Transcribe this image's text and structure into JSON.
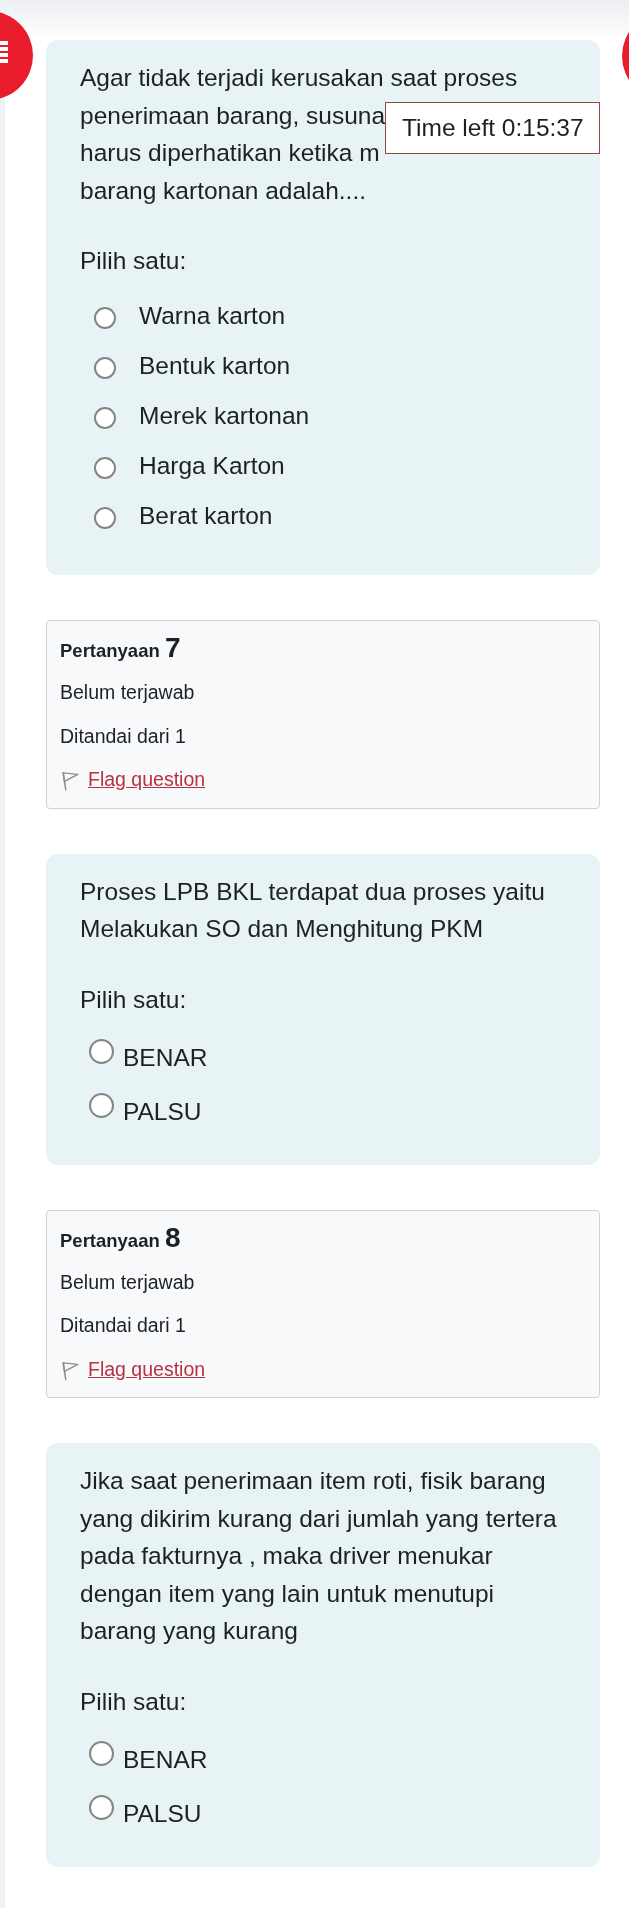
{
  "timer": {
    "text": "Time left 0:15:37"
  },
  "blocks": [
    {
      "kind": "multichoice",
      "text_lines": [
        "Agar tidak terjadi kerusakan saat proses",
        "penerimaan barang, susuna",
        "harus diperhatikan ketika m",
        "barang kartonan adalah...."
      ],
      "prompt": "Pilih satu:",
      "options": [
        {
          "label": "Warna karton",
          "selected": false
        },
        {
          "label": "Bentuk karton",
          "selected": false
        },
        {
          "label": "Merek kartonan",
          "selected": false
        },
        {
          "label": "Harga Karton",
          "selected": false
        },
        {
          "label": "Berat karton",
          "selected": false
        }
      ]
    },
    {
      "kind": "info",
      "title": "Pertanyaan",
      "number": "7",
      "status": "Belum terjawab",
      "marks": "Ditandai dari 1",
      "flag_link": "Flag question",
      "flagged": false
    },
    {
      "kind": "truefalse",
      "text": "Proses LPB BKL terdapat dua proses yaitu Melakukan SO dan Menghitung PKM",
      "prompt": "Pilih satu:",
      "options": [
        {
          "label": "BENAR",
          "selected": false
        },
        {
          "label": "PALSU",
          "selected": false
        }
      ]
    },
    {
      "kind": "info",
      "title": "Pertanyaan",
      "number": "8",
      "status": "Belum terjawab",
      "marks": "Ditandai dari 1",
      "flag_link": "Flag question",
      "flagged": false
    },
    {
      "kind": "truefalse",
      "text": "Jika saat penerimaan item roti, fisik barang yang dikirim kurang dari jumlah yang tertera pada fakturnya , maka driver menukar dengan item yang lain untuk menutupi barang yang kurang",
      "prompt": "Pilih satu:",
      "options": [
        {
          "label": "BENAR",
          "selected": false
        },
        {
          "label": "PALSU",
          "selected": false
        }
      ]
    }
  ]
}
